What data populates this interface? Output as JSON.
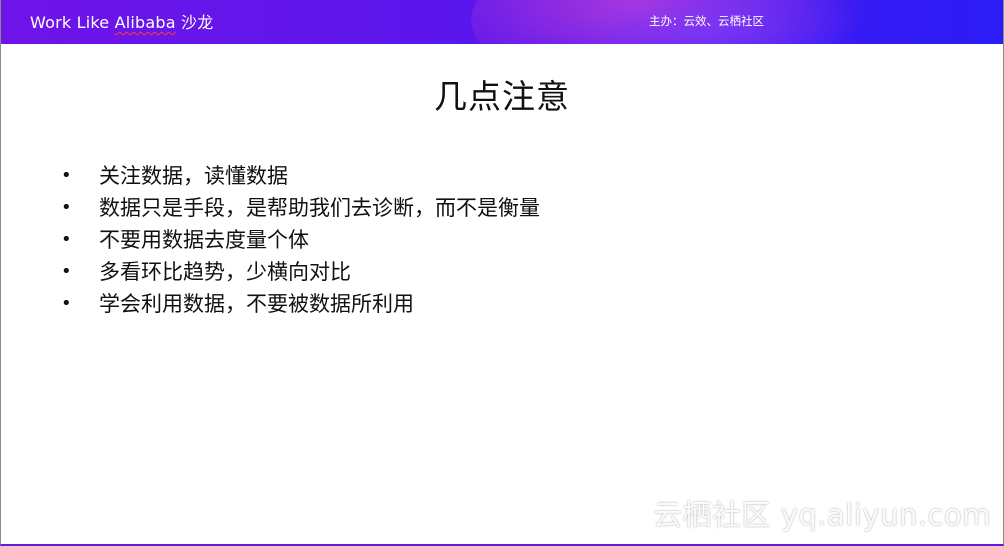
{
  "header": {
    "brand_prefix": "Work Like ",
    "brand_word": "Alibaba",
    "brand_suffix": " 沙龙",
    "sponsor": "主办：云效、云栖社区"
  },
  "slide": {
    "title": "几点注意",
    "bullet_symbol": "•",
    "bullets": [
      "关注数据，读懂数据",
      "数据只是手段，是帮助我们去诊断，而不是衡量",
      "不要用数据去度量个体",
      "多看环比趋势，少横向对比",
      "学会利用数据，不要被数据所利用"
    ]
  },
  "watermark": "云栖社区 yq.aliyun.com",
  "colors": {
    "header_start": "#6f14e8",
    "header_end": "#2b1cf5",
    "text": "#111111"
  }
}
